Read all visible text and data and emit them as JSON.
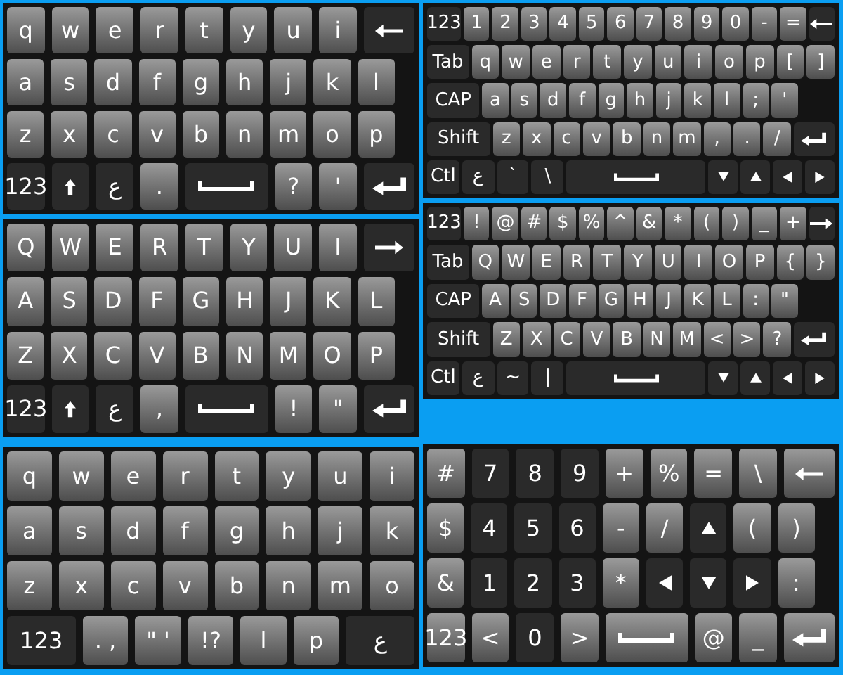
{
  "keyboards": [
    {
      "kind": "phone",
      "rows": [
        {
          "keys": [
            {
              "kind": "text",
              "label": "q",
              "dark": false
            },
            {
              "kind": "text",
              "label": "w",
              "dark": false
            },
            {
              "kind": "text",
              "label": "e",
              "dark": false
            },
            {
              "kind": "text",
              "label": "r",
              "dark": false
            },
            {
              "kind": "text",
              "label": "t",
              "dark": false
            },
            {
              "kind": "text",
              "label": "y",
              "dark": false
            },
            {
              "kind": "text",
              "label": "u",
              "dark": false
            },
            {
              "kind": "text",
              "label": "i",
              "dark": false
            },
            {
              "kind": "backspace",
              "dark": true
            }
          ]
        },
        {
          "keys": [
            {
              "kind": "text",
              "label": "a",
              "dark": false
            },
            {
              "kind": "text",
              "label": "s",
              "dark": false
            },
            {
              "kind": "text",
              "label": "d",
              "dark": false
            },
            {
              "kind": "text",
              "label": "f",
              "dark": false
            },
            {
              "kind": "text",
              "label": "g",
              "dark": false
            },
            {
              "kind": "text",
              "label": "h",
              "dark": false
            },
            {
              "kind": "text",
              "label": "j",
              "dark": false
            },
            {
              "kind": "text",
              "label": "k",
              "dark": false
            },
            {
              "kind": "text",
              "label": "l",
              "dark": false
            }
          ]
        },
        {
          "keys": [
            {
              "kind": "text",
              "label": "z",
              "dark": false
            },
            {
              "kind": "text",
              "label": "x",
              "dark": false
            },
            {
              "kind": "text",
              "label": "c",
              "dark": false
            },
            {
              "kind": "text",
              "label": "v",
              "dark": false
            },
            {
              "kind": "text",
              "label": "b",
              "dark": false
            },
            {
              "kind": "text",
              "label": "n",
              "dark": false
            },
            {
              "kind": "text",
              "label": "m",
              "dark": false
            },
            {
              "kind": "text",
              "label": "o",
              "dark": false
            },
            {
              "kind": "text",
              "label": "p",
              "dark": false
            }
          ]
        },
        {
          "keys": [
            {
              "kind": "text",
              "label": "123",
              "dark": true
            },
            {
              "kind": "shift",
              "dark": true
            },
            {
              "kind": "text",
              "label": "ع",
              "dark": true
            },
            {
              "kind": "text",
              "label": ".",
              "dark": false
            },
            {
              "kind": "space",
              "dark": true
            },
            {
              "kind": "text",
              "label": "?",
              "dark": false
            },
            {
              "kind": "text",
              "label": "'",
              "dark": false
            },
            {
              "kind": "enter",
              "dark": true
            }
          ]
        }
      ]
    },
    {
      "kind": "pc",
      "rows": [
        {
          "keys": [
            {
              "kind": "text",
              "label": "123",
              "dark": true
            },
            {
              "kind": "text",
              "label": "1",
              "dark": false
            },
            {
              "kind": "text",
              "label": "2",
              "dark": false
            },
            {
              "kind": "text",
              "label": "3",
              "dark": false
            },
            {
              "kind": "text",
              "label": "4",
              "dark": false
            },
            {
              "kind": "text",
              "label": "5",
              "dark": false
            },
            {
              "kind": "text",
              "label": "6",
              "dark": false
            },
            {
              "kind": "text",
              "label": "7",
              "dark": false
            },
            {
              "kind": "text",
              "label": "8",
              "dark": false
            },
            {
              "kind": "text",
              "label": "9",
              "dark": false
            },
            {
              "kind": "text",
              "label": "0",
              "dark": false
            },
            {
              "kind": "text",
              "label": "-",
              "dark": false
            },
            {
              "kind": "text",
              "label": "=",
              "dark": false
            },
            {
              "kind": "backspace",
              "dark": true
            }
          ]
        },
        {
          "keys": [
            {
              "kind": "text",
              "label": "Tab",
              "dark": true
            },
            {
              "kind": "text",
              "label": "q",
              "dark": false
            },
            {
              "kind": "text",
              "label": "w",
              "dark": false
            },
            {
              "kind": "text",
              "label": "e",
              "dark": false
            },
            {
              "kind": "text",
              "label": "r",
              "dark": false
            },
            {
              "kind": "text",
              "label": "t",
              "dark": false
            },
            {
              "kind": "text",
              "label": "y",
              "dark": false
            },
            {
              "kind": "text",
              "label": "u",
              "dark": false
            },
            {
              "kind": "text",
              "label": "i",
              "dark": false
            },
            {
              "kind": "text",
              "label": "o",
              "dark": false
            },
            {
              "kind": "text",
              "label": "p",
              "dark": false
            },
            {
              "kind": "text",
              "label": "[",
              "dark": false
            },
            {
              "kind": "text",
              "label": "]",
              "dark": false
            }
          ]
        },
        {
          "keys": [
            {
              "kind": "text",
              "label": "CAP",
              "dark": true
            },
            {
              "kind": "text",
              "label": "a",
              "dark": false
            },
            {
              "kind": "text",
              "label": "s",
              "dark": false
            },
            {
              "kind": "text",
              "label": "d",
              "dark": false
            },
            {
              "kind": "text",
              "label": "f",
              "dark": false
            },
            {
              "kind": "text",
              "label": "g",
              "dark": false
            },
            {
              "kind": "text",
              "label": "h",
              "dark": false
            },
            {
              "kind": "text",
              "label": "j",
              "dark": false
            },
            {
              "kind": "text",
              "label": "k",
              "dark": false
            },
            {
              "kind": "text",
              "label": "l",
              "dark": false
            },
            {
              "kind": "text",
              "label": ";",
              "dark": false
            },
            {
              "kind": "text",
              "label": "'",
              "dark": false
            }
          ]
        },
        {
          "keys": [
            {
              "kind": "text",
              "label": "Shift",
              "dark": true
            },
            {
              "kind": "text",
              "label": "z",
              "dark": false
            },
            {
              "kind": "text",
              "label": "x",
              "dark": false
            },
            {
              "kind": "text",
              "label": "c",
              "dark": false
            },
            {
              "kind": "text",
              "label": "v",
              "dark": false
            },
            {
              "kind": "text",
              "label": "b",
              "dark": false
            },
            {
              "kind": "text",
              "label": "n",
              "dark": false
            },
            {
              "kind": "text",
              "label": "m",
              "dark": false
            },
            {
              "kind": "text",
              "label": ",",
              "dark": false
            },
            {
              "kind": "text",
              "label": ".",
              "dark": false
            },
            {
              "kind": "text",
              "label": "/",
              "dark": false
            },
            {
              "kind": "enter",
              "dark": true
            }
          ]
        },
        {
          "keys": [
            {
              "kind": "text",
              "label": "Ctl",
              "dark": true
            },
            {
              "kind": "text",
              "label": "ع",
              "dark": true
            },
            {
              "kind": "text",
              "label": "`",
              "dark": true
            },
            {
              "kind": "text",
              "label": "\\",
              "dark": true
            },
            {
              "kind": "space",
              "dark": true
            },
            {
              "kind": "down",
              "dark": true
            },
            {
              "kind": "up",
              "dark": true
            },
            {
              "kind": "left",
              "dark": true
            },
            {
              "kind": "right",
              "dark": true
            }
          ]
        }
      ]
    },
    {
      "kind": "phone",
      "rows": [
        {
          "keys": [
            {
              "kind": "text",
              "label": "Q",
              "dark": false
            },
            {
              "kind": "text",
              "label": "W",
              "dark": false
            },
            {
              "kind": "text",
              "label": "E",
              "dark": false
            },
            {
              "kind": "text",
              "label": "R",
              "dark": false
            },
            {
              "kind": "text",
              "label": "T",
              "dark": false
            },
            {
              "kind": "text",
              "label": "Y",
              "dark": false
            },
            {
              "kind": "text",
              "label": "U",
              "dark": false
            },
            {
              "kind": "text",
              "label": "I",
              "dark": false
            },
            {
              "kind": "tab",
              "dark": true
            }
          ]
        },
        {
          "keys": [
            {
              "kind": "text",
              "label": "A",
              "dark": false
            },
            {
              "kind": "text",
              "label": "S",
              "dark": false
            },
            {
              "kind": "text",
              "label": "D",
              "dark": false
            },
            {
              "kind": "text",
              "label": "F",
              "dark": false
            },
            {
              "kind": "text",
              "label": "G",
              "dark": false
            },
            {
              "kind": "text",
              "label": "H",
              "dark": false
            },
            {
              "kind": "text",
              "label": "J",
              "dark": false
            },
            {
              "kind": "text",
              "label": "K",
              "dark": false
            },
            {
              "kind": "text",
              "label": "L",
              "dark": false
            }
          ]
        },
        {
          "keys": [
            {
              "kind": "text",
              "label": "Z",
              "dark": false
            },
            {
              "kind": "text",
              "label": "X",
              "dark": false
            },
            {
              "kind": "text",
              "label": "C",
              "dark": false
            },
            {
              "kind": "text",
              "label": "V",
              "dark": false
            },
            {
              "kind": "text",
              "label": "B",
              "dark": false
            },
            {
              "kind": "text",
              "label": "N",
              "dark": false
            },
            {
              "kind": "text",
              "label": "M",
              "dark": false
            },
            {
              "kind": "text",
              "label": "O",
              "dark": false
            },
            {
              "kind": "text",
              "label": "P",
              "dark": false
            }
          ]
        },
        {
          "keys": [
            {
              "kind": "text",
              "label": "123",
              "dark": true
            },
            {
              "kind": "shift",
              "dark": true
            },
            {
              "kind": "text",
              "label": "ع",
              "dark": true
            },
            {
              "kind": "text",
              "label": ",",
              "dark": false
            },
            {
              "kind": "space",
              "dark": true
            },
            {
              "kind": "text",
              "label": "!",
              "dark": false
            },
            {
              "kind": "text",
              "label": "\"",
              "dark": false
            },
            {
              "kind": "enter",
              "dark": true
            }
          ]
        }
      ]
    },
    {
      "kind": "pc",
      "rows": [
        {
          "keys": [
            {
              "kind": "text",
              "label": "123",
              "dark": true
            },
            {
              "kind": "text",
              "label": "!",
              "dark": false
            },
            {
              "kind": "text",
              "label": "@",
              "dark": false
            },
            {
              "kind": "text",
              "label": "#",
              "dark": false
            },
            {
              "kind": "text",
              "label": "$",
              "dark": false
            },
            {
              "kind": "text",
              "label": "%",
              "dark": false
            },
            {
              "kind": "text",
              "label": "^",
              "dark": false
            },
            {
              "kind": "text",
              "label": "&",
              "dark": false
            },
            {
              "kind": "text",
              "label": "*",
              "dark": false
            },
            {
              "kind": "text",
              "label": "(",
              "dark": false
            },
            {
              "kind": "text",
              "label": ")",
              "dark": false
            },
            {
              "kind": "text",
              "label": "_",
              "dark": false
            },
            {
              "kind": "text",
              "label": "+",
              "dark": false
            },
            {
              "kind": "tab",
              "dark": true
            }
          ]
        },
        {
          "keys": [
            {
              "kind": "text",
              "label": "Tab",
              "dark": true
            },
            {
              "kind": "text",
              "label": "Q",
              "dark": false
            },
            {
              "kind": "text",
              "label": "W",
              "dark": false
            },
            {
              "kind": "text",
              "label": "E",
              "dark": false
            },
            {
              "kind": "text",
              "label": "R",
              "dark": false
            },
            {
              "kind": "text",
              "label": "T",
              "dark": false
            },
            {
              "kind": "text",
              "label": "Y",
              "dark": false
            },
            {
              "kind": "text",
              "label": "U",
              "dark": false
            },
            {
              "kind": "text",
              "label": "I",
              "dark": false
            },
            {
              "kind": "text",
              "label": "O",
              "dark": false
            },
            {
              "kind": "text",
              "label": "P",
              "dark": false
            },
            {
              "kind": "text",
              "label": "{",
              "dark": false
            },
            {
              "kind": "text",
              "label": "}",
              "dark": false
            }
          ]
        },
        {
          "keys": [
            {
              "kind": "text",
              "label": "CAP",
              "dark": true
            },
            {
              "kind": "text",
              "label": "A",
              "dark": false
            },
            {
              "kind": "text",
              "label": "S",
              "dark": false
            },
            {
              "kind": "text",
              "label": "D",
              "dark": false
            },
            {
              "kind": "text",
              "label": "F",
              "dark": false
            },
            {
              "kind": "text",
              "label": "G",
              "dark": false
            },
            {
              "kind": "text",
              "label": "H",
              "dark": false
            },
            {
              "kind": "text",
              "label": "J",
              "dark": false
            },
            {
              "kind": "text",
              "label": "K",
              "dark": false
            },
            {
              "kind": "text",
              "label": "L",
              "dark": false
            },
            {
              "kind": "text",
              "label": ":",
              "dark": false
            },
            {
              "kind": "text",
              "label": "\"",
              "dark": false
            }
          ]
        },
        {
          "keys": [
            {
              "kind": "text",
              "label": "Shift",
              "dark": true
            },
            {
              "kind": "text",
              "label": "Z",
              "dark": false
            },
            {
              "kind": "text",
              "label": "X",
              "dark": false
            },
            {
              "kind": "text",
              "label": "C",
              "dark": false
            },
            {
              "kind": "text",
              "label": "V",
              "dark": false
            },
            {
              "kind": "text",
              "label": "B",
              "dark": false
            },
            {
              "kind": "text",
              "label": "N",
              "dark": false
            },
            {
              "kind": "text",
              "label": "M",
              "dark": false
            },
            {
              "kind": "text",
              "label": "<",
              "dark": false
            },
            {
              "kind": "text",
              "label": ">",
              "dark": false
            },
            {
              "kind": "text",
              "label": "?",
              "dark": false
            },
            {
              "kind": "enter",
              "dark": true
            }
          ]
        },
        {
          "keys": [
            {
              "kind": "text",
              "label": "Ctl",
              "dark": true
            },
            {
              "kind": "text",
              "label": "ع",
              "dark": true
            },
            {
              "kind": "text",
              "label": "~",
              "dark": true
            },
            {
              "kind": "text",
              "label": "|",
              "dark": true
            },
            {
              "kind": "space",
              "dark": true
            },
            {
              "kind": "down",
              "dark": true
            },
            {
              "kind": "up",
              "dark": true
            },
            {
              "kind": "left",
              "dark": true
            },
            {
              "kind": "right",
              "dark": true
            }
          ]
        }
      ]
    },
    {
      "kind": "compact",
      "rows": [
        {
          "keys": [
            {
              "kind": "text",
              "label": "q",
              "dark": false
            },
            {
              "kind": "text",
              "label": "w",
              "dark": false
            },
            {
              "kind": "text",
              "label": "e",
              "dark": false
            },
            {
              "kind": "text",
              "label": "r",
              "dark": false
            },
            {
              "kind": "text",
              "label": "t",
              "dark": false
            },
            {
              "kind": "text",
              "label": "y",
              "dark": false
            },
            {
              "kind": "text",
              "label": "u",
              "dark": false
            },
            {
              "kind": "text",
              "label": "i",
              "dark": false
            }
          ]
        },
        {
          "keys": [
            {
              "kind": "text",
              "label": "a",
              "dark": false
            },
            {
              "kind": "text",
              "label": "s",
              "dark": false
            },
            {
              "kind": "text",
              "label": "d",
              "dark": false
            },
            {
              "kind": "text",
              "label": "f",
              "dark": false
            },
            {
              "kind": "text",
              "label": "g",
              "dark": false
            },
            {
              "kind": "text",
              "label": "h",
              "dark": false
            },
            {
              "kind": "text",
              "label": "j",
              "dark": false
            },
            {
              "kind": "text",
              "label": "k",
              "dark": false
            }
          ]
        },
        {
          "keys": [
            {
              "kind": "text",
              "label": "z",
              "dark": false
            },
            {
              "kind": "text",
              "label": "x",
              "dark": false
            },
            {
              "kind": "text",
              "label": "c",
              "dark": false
            },
            {
              "kind": "text",
              "label": "v",
              "dark": false
            },
            {
              "kind": "text",
              "label": "b",
              "dark": false
            },
            {
              "kind": "text",
              "label": "n",
              "dark": false
            },
            {
              "kind": "text",
              "label": "m",
              "dark": false
            },
            {
              "kind": "text",
              "label": "o",
              "dark": false
            }
          ]
        },
        {
          "keys": [
            {
              "kind": "text",
              "label": "123",
              "dark": true
            },
            {
              "kind": "text",
              "label": ". ,",
              "dark": false
            },
            {
              "kind": "text",
              "label": "\" '",
              "dark": false
            },
            {
              "kind": "text",
              "label": "!?",
              "dark": false
            },
            {
              "kind": "text",
              "label": "l",
              "dark": false
            },
            {
              "kind": "text",
              "label": "p",
              "dark": false
            },
            {
              "kind": "text",
              "label": "ع",
              "dark": true
            }
          ]
        }
      ]
    },
    {
      "kind": "numpad",
      "rows": [
        {
          "keys": [
            {
              "kind": "text",
              "label": "#",
              "dark": false
            },
            {
              "kind": "text",
              "label": "7",
              "dark": true
            },
            {
              "kind": "text",
              "label": "8",
              "dark": true
            },
            {
              "kind": "text",
              "label": "9",
              "dark": true
            },
            {
              "kind": "text",
              "label": "+",
              "dark": false
            },
            {
              "kind": "text",
              "label": "%",
              "dark": false
            },
            {
              "kind": "text",
              "label": "=",
              "dark": false
            },
            {
              "kind": "text",
              "label": "\\",
              "dark": false
            },
            {
              "kind": "backspace",
              "dark": false
            }
          ]
        },
        {
          "keys": [
            {
              "kind": "text",
              "label": "$",
              "dark": false
            },
            {
              "kind": "text",
              "label": "4",
              "dark": true
            },
            {
              "kind": "text",
              "label": "5",
              "dark": true
            },
            {
              "kind": "text",
              "label": "6",
              "dark": true
            },
            {
              "kind": "text",
              "label": "-",
              "dark": false
            },
            {
              "kind": "text",
              "label": "/",
              "dark": false
            },
            {
              "kind": "up",
              "dark": true
            },
            {
              "kind": "text",
              "label": "(",
              "dark": false
            },
            {
              "kind": "text",
              "label": ")",
              "dark": false
            }
          ]
        },
        {
          "keys": [
            {
              "kind": "text",
              "label": "&",
              "dark": false
            },
            {
              "kind": "text",
              "label": "1",
              "dark": true
            },
            {
              "kind": "text",
              "label": "2",
              "dark": true
            },
            {
              "kind": "text",
              "label": "3",
              "dark": true
            },
            {
              "kind": "text",
              "label": "*",
              "dark": false
            },
            {
              "kind": "left",
              "dark": true
            },
            {
              "kind": "down",
              "dark": true
            },
            {
              "kind": "right",
              "dark": true
            },
            {
              "kind": "text",
              "label": ":",
              "dark": false
            }
          ]
        },
        {
          "keys": [
            {
              "kind": "text",
              "label": "123",
              "dark": false
            },
            {
              "kind": "text",
              "label": "<",
              "dark": false
            },
            {
              "kind": "text",
              "label": "0",
              "dark": true
            },
            {
              "kind": "text",
              "label": ">",
              "dark": false
            },
            {
              "kind": "space",
              "dark": false
            },
            {
              "kind": "text",
              "label": "@",
              "dark": false
            },
            {
              "kind": "text",
              "label": "_",
              "dark": false
            },
            {
              "kind": "enter",
              "dark": false
            }
          ]
        }
      ]
    }
  ]
}
